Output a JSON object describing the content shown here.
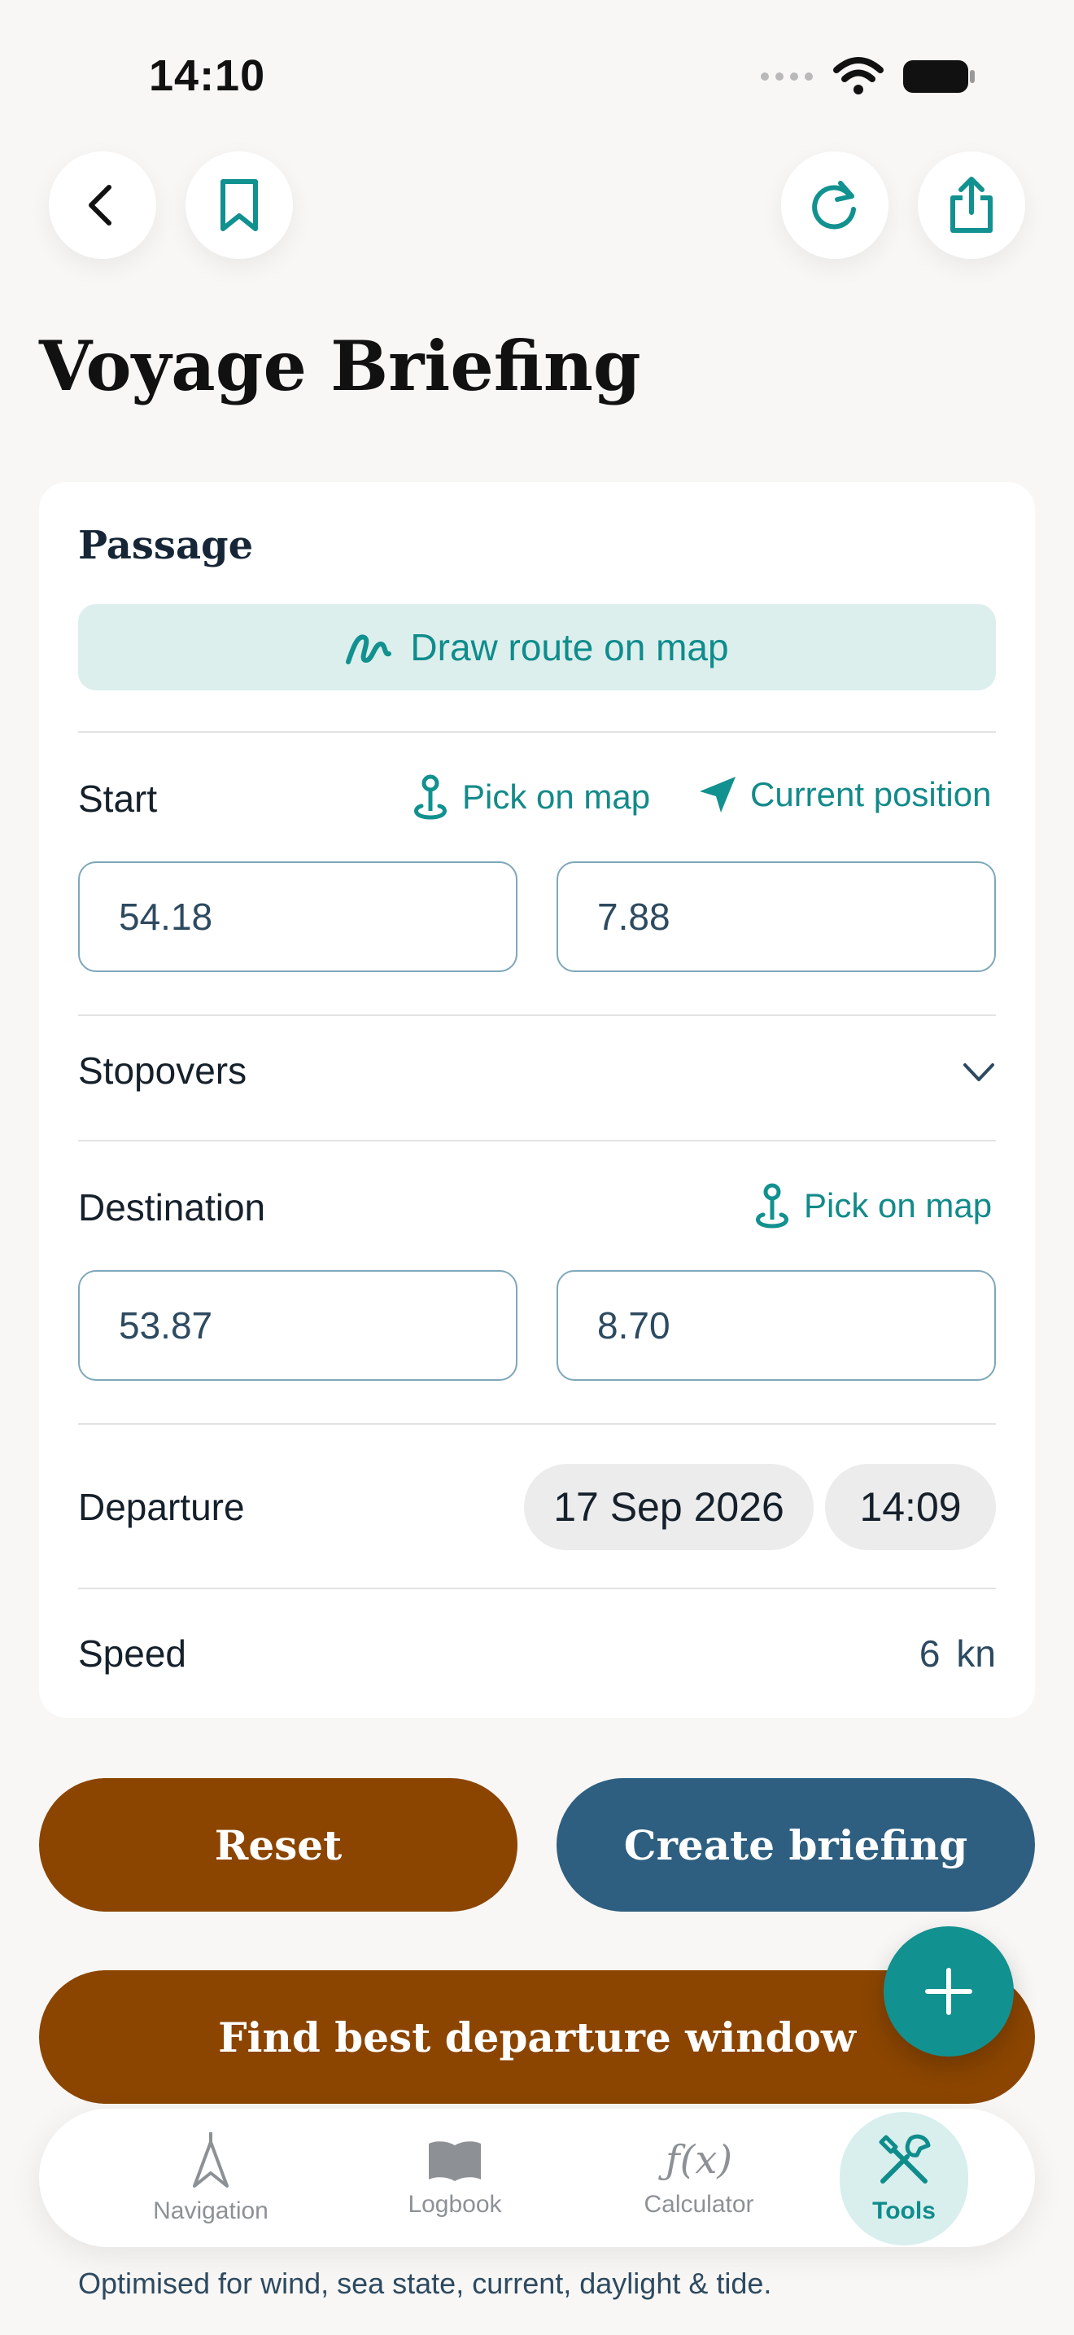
{
  "status": {
    "time": "14:10"
  },
  "header": {
    "title": "Voyage Briefing"
  },
  "passage": {
    "title": "Passage",
    "draw_route_label": "Draw route on map",
    "start": {
      "label": "Start",
      "pick_on_map": "Pick on map",
      "current_position": "Current position",
      "lat": "54.18",
      "lon": "7.88"
    },
    "stopovers": {
      "label": "Stopovers"
    },
    "destination": {
      "label": "Destination",
      "pick_on_map": "Pick on map",
      "lat": "53.87",
      "lon": "8.70"
    },
    "departure": {
      "label": "Departure",
      "date": "17 Sep 2026",
      "time": "14:09"
    },
    "speed": {
      "label": "Speed",
      "value": "6",
      "unit": "kn"
    }
  },
  "actions": {
    "reset": "Reset",
    "create_briefing": "Create briefing",
    "find_window": "Find best departure window"
  },
  "tabs": [
    {
      "label": "Navigation"
    },
    {
      "label": "Logbook"
    },
    {
      "label": "Calculator"
    },
    {
      "label": "Tools"
    }
  ],
  "footer": {
    "note": "Optimised for wind, sea state, current, daylight & tide."
  },
  "colors": {
    "accent": "#11918f",
    "brown": "#8b4500",
    "blue": "#2e5f80"
  }
}
